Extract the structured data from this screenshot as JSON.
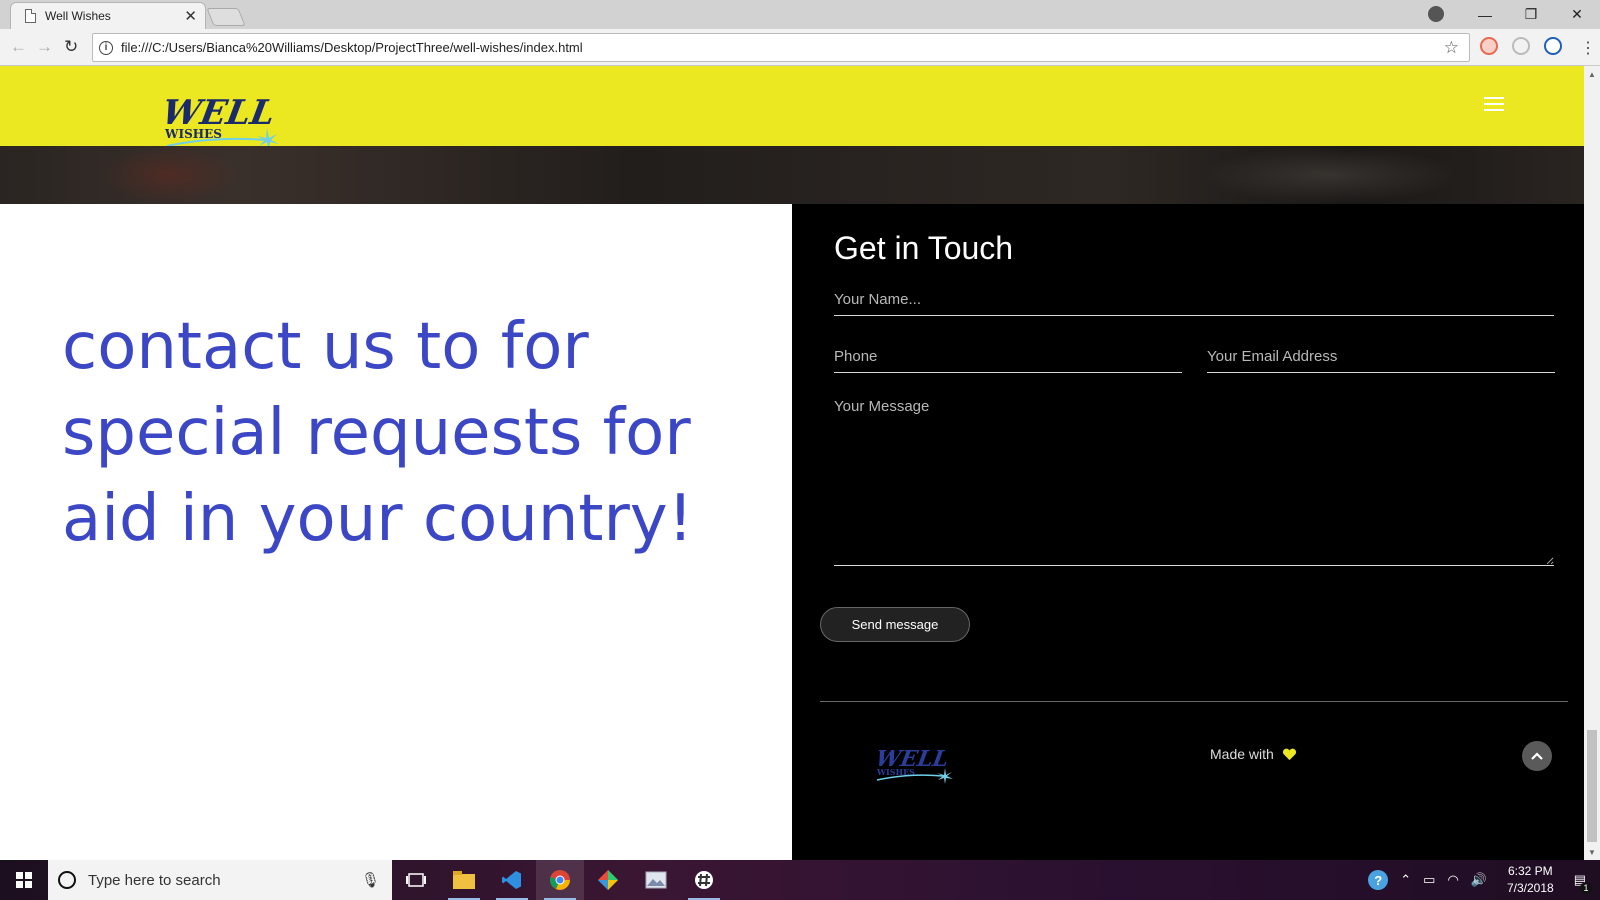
{
  "browser": {
    "tab_title": "Well Wishes",
    "tab_close": "✕",
    "url": "file:///C:/Users/Bianca%20Williams/Desktop/ProjectThree/well-wishes/index.html"
  },
  "site": {
    "brand_accent": "#ebe721",
    "headline_color": "#3c47c6",
    "promo_text": "contact us to for special requests for aid in your country!",
    "contact": {
      "title": "Get in Touch",
      "name_placeholder": "Your Name...",
      "phone_placeholder": "Phone",
      "email_placeholder": "Your Email Address",
      "message_placeholder": "Your Message",
      "send_label": "Send message"
    },
    "footer": {
      "made_with": "Made with"
    }
  },
  "taskbar": {
    "search_placeholder": "Type here to search",
    "time": "6:32 PM",
    "date": "7/3/2018",
    "notification_count": "1"
  },
  "icons": [
    "page-icon",
    "info-icon",
    "star-icon",
    "menu-icon",
    "heart-icon",
    "chevron-up-icon",
    "windows-icon",
    "search-icon",
    "mic-icon"
  ]
}
